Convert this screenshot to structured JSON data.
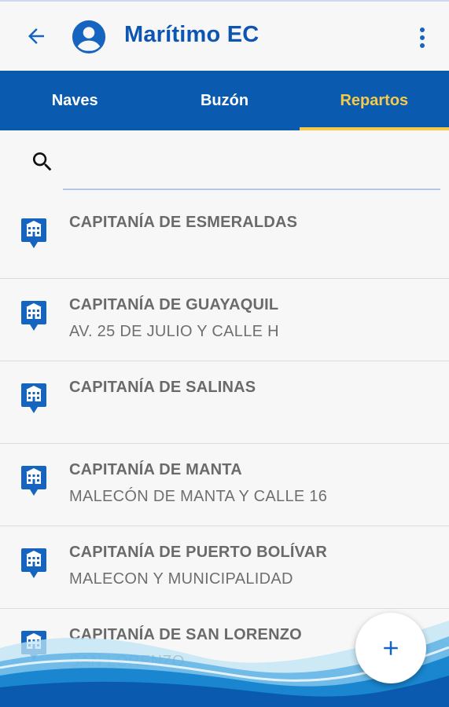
{
  "header": {
    "title": "Marítimo EC",
    "back_icon": "arrow-left-icon",
    "avatar_icon": "account-circle-icon",
    "menu_icon": "more-vertical-icon",
    "accent": "#0d55b3"
  },
  "tabs": [
    {
      "label": "Naves",
      "active": false
    },
    {
      "label": "Buzón",
      "active": false
    },
    {
      "label": "Repartos",
      "active": true
    }
  ],
  "search": {
    "value": "",
    "placeholder": ""
  },
  "items": [
    {
      "name": "CAPITANÍA DE ESMERALDAS",
      "address": ""
    },
    {
      "name": "CAPITANÍA DE GUAYAQUIL",
      "address": "AV. 25 DE JULIO Y CALLE H"
    },
    {
      "name": "CAPITANÍA DE SALINAS",
      "address": ""
    },
    {
      "name": "CAPITANÍA DE MANTA",
      "address": "MALECÓN DE MANTA Y CALLE 16"
    },
    {
      "name": "CAPITANÍA DE PUERTO BOLÍVAR",
      "address": "MALECON Y MUNICIPALIDAD"
    },
    {
      "name": "CAPITANÍA DE SAN LORENZO",
      "address": "SAN LORENZO"
    }
  ],
  "colors": {
    "tab_bar": "#0a5bb0",
    "tab_active": "#f6c94a",
    "pin": "#1565c0"
  },
  "fab": {
    "icon": "plus-icon"
  }
}
